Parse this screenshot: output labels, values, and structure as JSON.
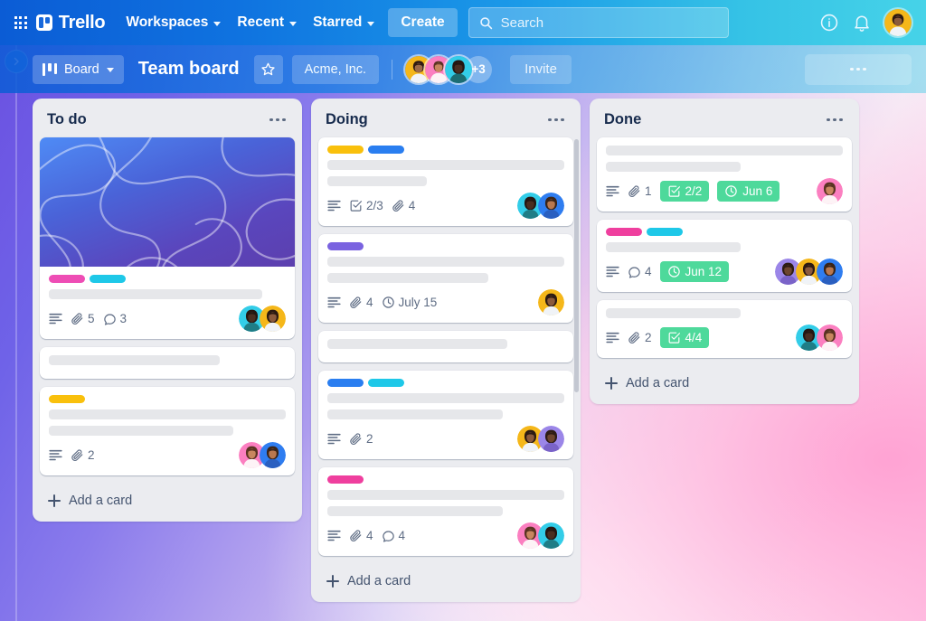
{
  "topnav": {
    "apps_icon": "grid-apps-icon",
    "logo_text": "Trello",
    "menus": [
      {
        "label": "Workspaces"
      },
      {
        "label": "Recent"
      },
      {
        "label": "Starred"
      }
    ],
    "create_label": "Create",
    "search": {
      "value": "",
      "placeholder": "Search",
      "icon": "search-icon"
    },
    "info_icon": "info-circle-icon",
    "notifications_icon": "bell-icon",
    "account_avatar": "user-avatar"
  },
  "boardbar": {
    "view_label": "Board",
    "view_icon": "board-view-icon",
    "title": "Team board",
    "star_icon": "star-icon",
    "workspace_label": "Acme, Inc.",
    "members_overflow": "+3",
    "invite_label": "Invite",
    "menu_icon": "more-horizontal-icon"
  },
  "sidebar": {
    "expand_icon": "chevron-right-icon"
  },
  "colors": {
    "label_pink": "#ee4db5",
    "label_cyan": "#1ec8e8",
    "label_yellow": "#f9c00c",
    "label_blue": "#2a7ef0",
    "label_purple": "#7a63e0",
    "label_magenta": "#ef3f9e",
    "badge_green": "#4ed99b",
    "list_bg": "#ebecf0",
    "card_bg": "#ffffff",
    "text_dark": "#172b4d",
    "text_muted": "#5e6c84"
  },
  "lists": [
    {
      "title": "To do",
      "menu_icon": "more-horizontal-icon",
      "add_card_label": "Add a card",
      "has_scrollbar": false,
      "cards": [
        {
          "cover": "abstract-blue-waves",
          "labels": [
            "#ee4db5",
            "#1ec8e8"
          ],
          "placeholder_lines": [
            90
          ],
          "badges": [
            {
              "icon": "description-icon",
              "text": ""
            },
            {
              "icon": "attachment-icon",
              "text": "5"
            },
            {
              "icon": "comment-icon",
              "text": "3"
            }
          ],
          "members": [
            "cyan",
            "amber"
          ]
        },
        {
          "cover": null,
          "labels": [],
          "placeholder_lines": [
            72
          ],
          "badges": [],
          "members": []
        },
        {
          "cover": null,
          "labels": [
            "#f9c00c"
          ],
          "placeholder_lines": [
            100,
            78
          ],
          "badges": [
            {
              "icon": "description-icon",
              "text": ""
            },
            {
              "icon": "attachment-icon",
              "text": "2"
            }
          ],
          "members": [
            "pink",
            "blue"
          ]
        }
      ]
    },
    {
      "title": "Doing",
      "menu_icon": "more-horizontal-icon",
      "add_card_label": "Add a card",
      "has_scrollbar": true,
      "cards": [
        {
          "cover": null,
          "labels": [
            "#f9c00c",
            "#2a7ef0"
          ],
          "placeholder_lines": [
            100,
            42
          ],
          "badges": [
            {
              "icon": "description-icon",
              "text": ""
            },
            {
              "icon": "checklist-icon",
              "text": "2/3"
            },
            {
              "icon": "attachment-icon",
              "text": "4"
            }
          ],
          "members": [
            "cyan",
            "blue"
          ]
        },
        {
          "cover": null,
          "labels": [
            "#7a63e0"
          ],
          "placeholder_lines": [
            100,
            68
          ],
          "badges": [
            {
              "icon": "description-icon",
              "text": ""
            },
            {
              "icon": "attachment-icon",
              "text": "4"
            },
            {
              "icon": "clock-icon",
              "text": "July 15"
            }
          ],
          "members": [
            "amber"
          ]
        },
        {
          "cover": null,
          "labels": [],
          "placeholder_lines": [
            76
          ],
          "badges": [],
          "members": []
        },
        {
          "cover": null,
          "labels": [
            "#2a7ef0",
            "#1ec8e8"
          ],
          "placeholder_lines": [
            100,
            74
          ],
          "badges": [
            {
              "icon": "description-icon",
              "text": ""
            },
            {
              "icon": "attachment-icon",
              "text": "2"
            }
          ],
          "members": [
            "amber",
            "purple"
          ]
        },
        {
          "cover": null,
          "labels": [
            "#ef3f9e"
          ],
          "placeholder_lines": [
            100,
            74
          ],
          "badges": [
            {
              "icon": "description-icon",
              "text": ""
            },
            {
              "icon": "attachment-icon",
              "text": "4"
            },
            {
              "icon": "comment-icon",
              "text": "4"
            }
          ],
          "members": [
            "pink",
            "cyan"
          ]
        }
      ]
    },
    {
      "title": "Done",
      "menu_icon": "more-horizontal-icon",
      "add_card_label": "Add a card",
      "has_scrollbar": false,
      "cards": [
        {
          "cover": null,
          "labels": [],
          "placeholder_lines": [
            100,
            57
          ],
          "badges": [
            {
              "icon": "description-icon",
              "text": ""
            },
            {
              "icon": "attachment-icon",
              "text": "1"
            },
            {
              "icon": "checklist-icon",
              "text": "2/2",
              "style": "green"
            },
            {
              "icon": "clock-icon",
              "text": "Jun 6",
              "style": "green"
            }
          ],
          "members": [
            "pink"
          ]
        },
        {
          "cover": null,
          "labels": [
            "#ef3f9e",
            "#1ec8e8"
          ],
          "placeholder_lines": [
            57
          ],
          "badges": [
            {
              "icon": "description-icon",
              "text": ""
            },
            {
              "icon": "comment-icon",
              "text": "4"
            },
            {
              "icon": "clock-icon",
              "text": "Jun 12",
              "style": "green"
            }
          ],
          "members": [
            "purple",
            "amber",
            "blue"
          ]
        },
        {
          "cover": null,
          "labels": [],
          "placeholder_lines": [
            57
          ],
          "badges": [
            {
              "icon": "description-icon",
              "text": ""
            },
            {
              "icon": "attachment-icon",
              "text": "2"
            },
            {
              "icon": "checklist-icon",
              "text": "4/4",
              "style": "green"
            }
          ],
          "members": [
            "cyan",
            "pink"
          ]
        }
      ]
    }
  ]
}
